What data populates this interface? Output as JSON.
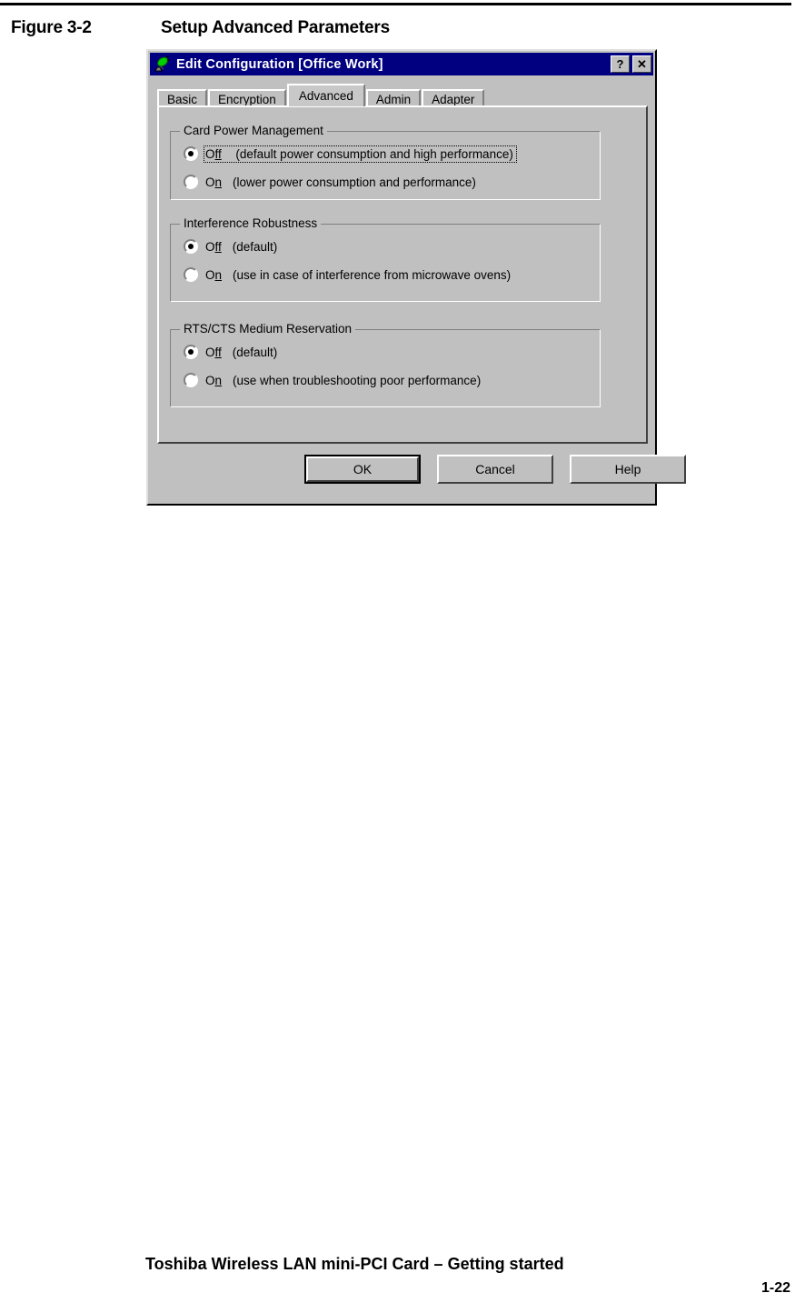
{
  "page": {
    "figure": {
      "number": "Figure 3-2",
      "title": "Setup Advanced Parameters"
    },
    "footer": {
      "title": "Toshiba Wireless LAN mini-PCI Card – Getting started",
      "page_number": "1-22"
    }
  },
  "dialog": {
    "title": "Edit Configuration [Office Work]",
    "icon": "antenna-icon",
    "titlebar_color": "#000080",
    "face_color": "#c0c0c0",
    "buttons": {
      "help_glyph": "?",
      "close_glyph": "✕"
    },
    "tabs": [
      {
        "label": "Basic",
        "active": false
      },
      {
        "label": "Encryption",
        "active": false
      },
      {
        "label": "Advanced",
        "active": true
      },
      {
        "label": "Admin",
        "active": false
      },
      {
        "label": "Adapter",
        "active": false
      }
    ],
    "groups": [
      {
        "title": "Card Power Management",
        "options": [
          {
            "label_pre": "O",
            "label_acc": "ff",
            "label_post": "",
            "description": "(default power consumption and high performance)",
            "selected": true,
            "focused": true
          },
          {
            "label_pre": "O",
            "label_acc": "n",
            "label_post": "",
            "description": "(lower power consumption and performance)",
            "selected": false,
            "focused": false
          }
        ]
      },
      {
        "title": "Interference Robustness",
        "options": [
          {
            "label_pre": "O",
            "label_acc": "ff",
            "label_post": "",
            "description": "(default)",
            "selected": true,
            "focused": false
          },
          {
            "label_pre": "O",
            "label_acc": "n",
            "label_post": "",
            "description": "(use in case of interference from microwave ovens)",
            "selected": false,
            "focused": false
          }
        ]
      },
      {
        "title": "RTS/CTS Medium Reservation",
        "options": [
          {
            "label_pre": "O",
            "label_acc": "ff",
            "label_post": "",
            "description": "(default)",
            "selected": true,
            "focused": false
          },
          {
            "label_pre": "O",
            "label_acc": "n",
            "label_post": "",
            "description": "(use when troubleshooting poor performance)",
            "selected": false,
            "focused": false
          }
        ]
      }
    ],
    "actions": {
      "ok": "OK",
      "cancel": "Cancel",
      "help": "Help"
    }
  }
}
